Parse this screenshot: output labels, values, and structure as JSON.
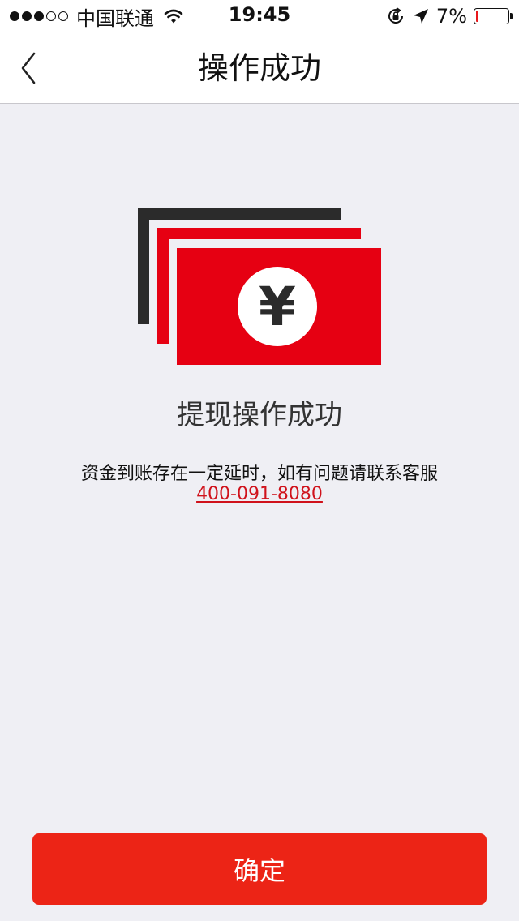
{
  "status_bar": {
    "carrier": "中国联通",
    "time": "19:45",
    "battery_text": "7%",
    "battery_level": 0.07,
    "signal_strength": 3,
    "signal_max": 5
  },
  "nav": {
    "title": "操作成功",
    "back_icon": "chevron-left-icon"
  },
  "illustration": {
    "symbol": "¥",
    "colors": {
      "bill_back": "#2b2b2b",
      "bill_front": "#e60012",
      "coin": "#ffffff"
    }
  },
  "content": {
    "success_title": "提现操作成功",
    "notice_text": "资金到账存在一定延时，如有问题请联系客服",
    "phone": "400-091-8080"
  },
  "footer": {
    "confirm_label": "确定"
  },
  "colors": {
    "accent": "#ec2416",
    "link": "#d0121b",
    "background": "#efeff4"
  }
}
